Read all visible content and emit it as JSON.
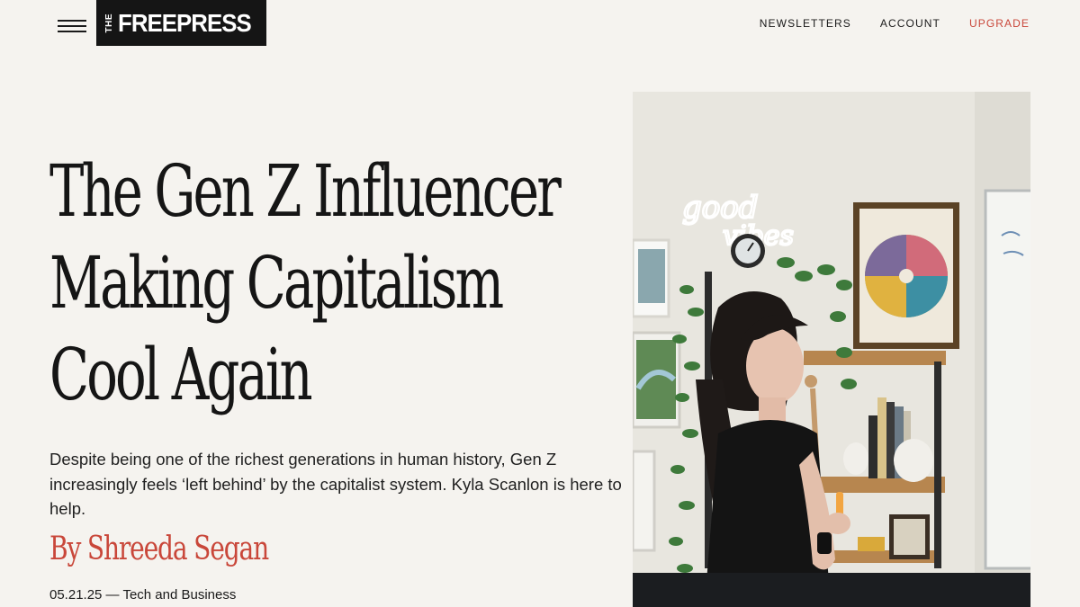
{
  "header": {
    "logo_the": "THE",
    "logo_main": "FREEPRESS",
    "nav": [
      {
        "label": "NEWSLETTERS"
      },
      {
        "label": "ACCOUNT"
      },
      {
        "label": "UPGRADE"
      }
    ]
  },
  "article": {
    "headline_lines": [
      "The Gen Z Influencer",
      "Making Capitalism",
      "Cool Again"
    ],
    "dek": "Despite being one of the richest generations in human history, Gen Z increasingly feels ‘left behind’ by the capitalist system. Kyla Scanlon is here to help.",
    "byline": "By Shreeda Segan",
    "meta": "05.21.25 — Tech and Business"
  },
  "hero": {
    "neon_line1": "good",
    "neon_line2": "vibes"
  },
  "colors": {
    "background": "#f5f3ef",
    "accent": "#c9473a",
    "logo_bg": "#151515"
  }
}
